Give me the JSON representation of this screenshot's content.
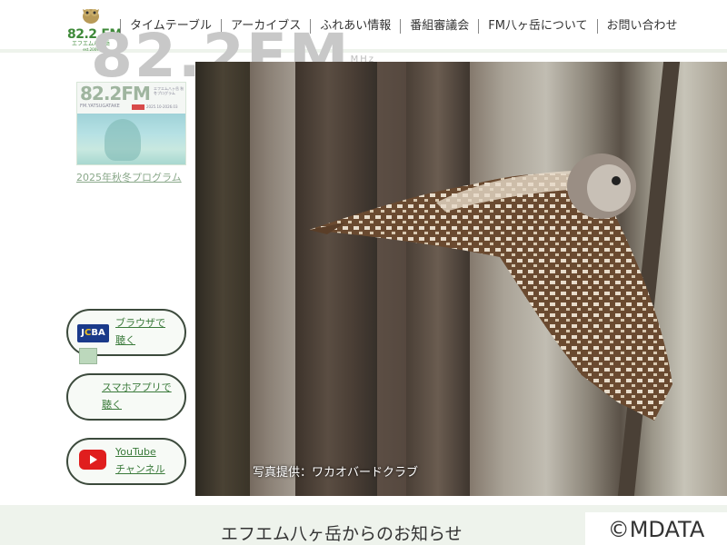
{
  "header": {
    "logo": {
      "freq": "82.2.FM",
      "sub": "エフエム八ヶ岳",
      "sub2": "est.2009"
    },
    "nav": [
      {
        "label": "タイムテーブル"
      },
      {
        "label": "アーカイブス"
      },
      {
        "label": "ふれあい情報"
      },
      {
        "label": "番組審議会"
      },
      {
        "label": "FM八ヶ岳について"
      },
      {
        "label": "お問い合わせ"
      }
    ]
  },
  "big_logo": {
    "freq": "82.2FM",
    "unit": "MHz"
  },
  "banner": {
    "freq": "82.2FM",
    "station": "FM.YATSUGATAKE",
    "right_text": "エフエム八ヶ岳 秋冬プログラム",
    "date": "2025.10-2026.03",
    "link": "2025年秋冬プログラム"
  },
  "listen": {
    "browser": {
      "line1": "ブラウザで",
      "line2": "聴く",
      "icon_text": "JCBA"
    },
    "app": {
      "line1": "スマホアプリで",
      "line2": "聴く"
    },
    "youtube": {
      "line1": "YouTube",
      "line2": "チャンネル"
    }
  },
  "photo": {
    "credit": "写真提供：ワカオバードクラブ"
  },
  "notice": {
    "title": "エフエム八ヶ岳からのお知らせ"
  },
  "watermark": "©MDATA",
  "colors": {
    "brand_green": "#3f8a3a",
    "bg_band": "#eef3ec",
    "youtube_red": "#e01e1e",
    "jcba_blue": "#1a3a8a"
  }
}
